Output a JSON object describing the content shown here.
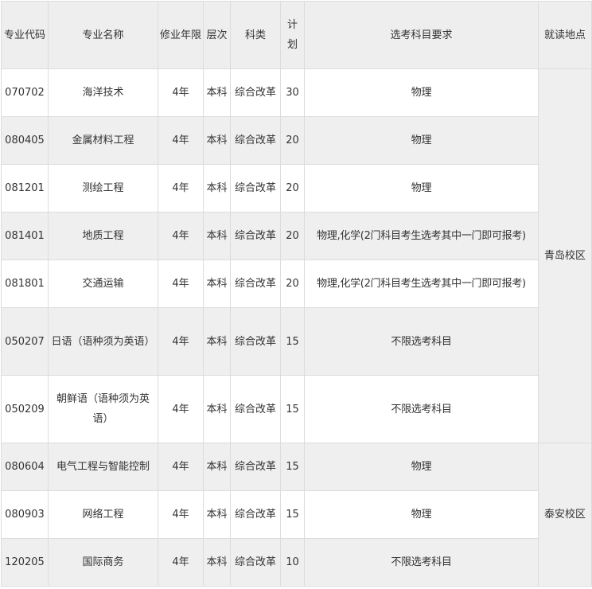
{
  "headers": {
    "code": "专业代码",
    "name": "专业名称",
    "years": "修业年限",
    "level": "层次",
    "category": "科类",
    "plan": "计划",
    "requirement": "选考科目要求",
    "location": "就读地点"
  },
  "rows": [
    {
      "code": "070702",
      "name": "海洋技术",
      "years": "4年",
      "level": "本科",
      "category": "综合改革",
      "plan": "30",
      "requirement": "物理"
    },
    {
      "code": "080405",
      "name": "金属材料工程",
      "years": "4年",
      "level": "本科",
      "category": "综合改革",
      "plan": "20",
      "requirement": "物理"
    },
    {
      "code": "081201",
      "name": "测绘工程",
      "years": "4年",
      "level": "本科",
      "category": "综合改革",
      "plan": "20",
      "requirement": "物理"
    },
    {
      "code": "081401",
      "name": "地质工程",
      "years": "4年",
      "level": "本科",
      "category": "综合改革",
      "plan": "20",
      "requirement": "物理,化学(2门科目考生选考其中一门即可报考)"
    },
    {
      "code": "081801",
      "name": "交通运输",
      "years": "4年",
      "level": "本科",
      "category": "综合改革",
      "plan": "20",
      "requirement": "物理,化学(2门科目考生选考其中一门即可报考)"
    },
    {
      "code": "050207",
      "name": "日语（语种须为英语）",
      "years": "4年",
      "level": "本科",
      "category": "综合改革",
      "plan": "15",
      "requirement": "不限选考科目"
    },
    {
      "code": "050209",
      "name": "朝鲜语（语种须为英语）",
      "years": "4年",
      "level": "本科",
      "category": "综合改革",
      "plan": "15",
      "requirement": "不限选考科目"
    },
    {
      "code": "080604",
      "name": "电气工程与智能控制",
      "years": "4年",
      "level": "本科",
      "category": "综合改革",
      "plan": "15",
      "requirement": "物理"
    },
    {
      "code": "080903",
      "name": "网络工程",
      "years": "4年",
      "level": "本科",
      "category": "综合改革",
      "plan": "15",
      "requirement": "物理"
    },
    {
      "code": "120205",
      "name": "国际商务",
      "years": "4年",
      "level": "本科",
      "category": "综合改革",
      "plan": "10",
      "requirement": "不限选考科目"
    }
  ],
  "campuses": {
    "qingdao": "青岛校区",
    "taian": "泰安校区"
  }
}
